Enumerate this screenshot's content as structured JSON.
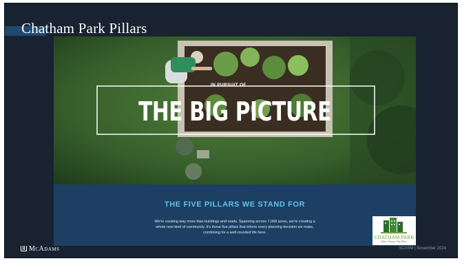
{
  "slide": {
    "title": "Chatham Park Pillars",
    "hero": {
      "kicker": "IN PURSUIT OF",
      "headline": "THE BIG PICTURE"
    },
    "band": {
      "heading": "THE FIVE PILLARS WE STAND FOR",
      "body_lines": [
        "We're creating way more than buildings and roads. Spanning across 7,068 acres, we're creating a",
        "whole new kind of community. It's these five pillars that inform every planning decision we make,",
        "combining for a well-rounded life here."
      ]
    },
    "logo": {
      "name": "CHATHAM PARK",
      "tagline": "Many Choices. One Place."
    },
    "footer": {
      "company": "McAdams",
      "info": "SCASM | November 2024"
    }
  },
  "colors": {
    "slide_bg": "#182230",
    "band_bg": "#1c3f63",
    "band_heading": "#62c3e6",
    "logo_green": "#6ea23a",
    "logo_building": "#2e6b2e"
  }
}
